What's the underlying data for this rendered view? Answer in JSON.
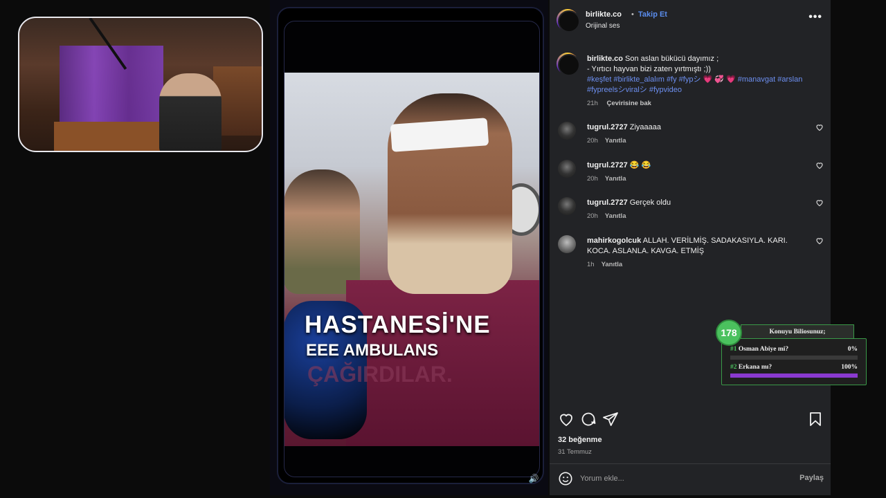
{
  "post": {
    "username": "birlikte.co",
    "separator": "•",
    "follow_label": "Takip Et",
    "audio_label": "Orijinal ses",
    "more_label": "•••"
  },
  "caption": {
    "username": "birlikte.co",
    "line1": "Son aslan bükücü dayımız ;",
    "line2": "- Yırtıcı hayvan bizi zaten yırtmıştı ;))",
    "tags": "#keşfet #birlikte_alalım #fy #fypシ 💗 💞 💗 #manavgat #arslan #fypreelsシviralシ #fypvideo",
    "time": "21h",
    "translate_label": "Çevirisine bak"
  },
  "comments": [
    {
      "username": "tugrul.2727",
      "text": "Ziyaaaaa",
      "time": "20h",
      "reply_label": "Yanıtla"
    },
    {
      "username": "tugrul.2727",
      "text": "😂 😂",
      "time": "20h",
      "reply_label": "Yanıtla"
    },
    {
      "username": "tugrul.2727",
      "text": "Gerçek oldu",
      "time": "20h",
      "reply_label": "Yanıtla"
    },
    {
      "username": "mahirkogolcuk",
      "text": "ALLAH. VERİLMİŞ. SADAKASIYLA. KARI. KOCA. ASLANLA. KAVGA. ETMİŞ",
      "time": "1h",
      "reply_label": "Yanıtla"
    }
  ],
  "stats": {
    "likes": "32 beğenme",
    "date": "31 Temmuz"
  },
  "comment_box": {
    "placeholder": "Yorum ekle...",
    "share_label": "Paylaş"
  },
  "video": {
    "caption_line1": "HASTANESİ'NE",
    "caption_line2": "EEE AMBULANS",
    "caption_line3": "ÇAĞIRDILAR.",
    "mute_icon": "🔊"
  },
  "poll": {
    "badge": "178",
    "title": "Konuyu Biliosunuz;",
    "options": [
      {
        "num": "#1",
        "label": "Osman Abiye mi?",
        "pct": "0%",
        "fraction": 0.0
      },
      {
        "num": "#2",
        "label": "Erkana mı?",
        "pct": "100%",
        "fraction": 1.0
      }
    ]
  },
  "colors": {
    "panel_bg": "#222326",
    "link_blue": "#5a8dee",
    "poll_green": "#4bc15e",
    "poll_purple": "#8a3ad0"
  },
  "icons": [
    "heart-icon",
    "comment-icon",
    "share-icon",
    "bookmark-icon",
    "emoji-icon",
    "more-icon",
    "volume-icon"
  ]
}
